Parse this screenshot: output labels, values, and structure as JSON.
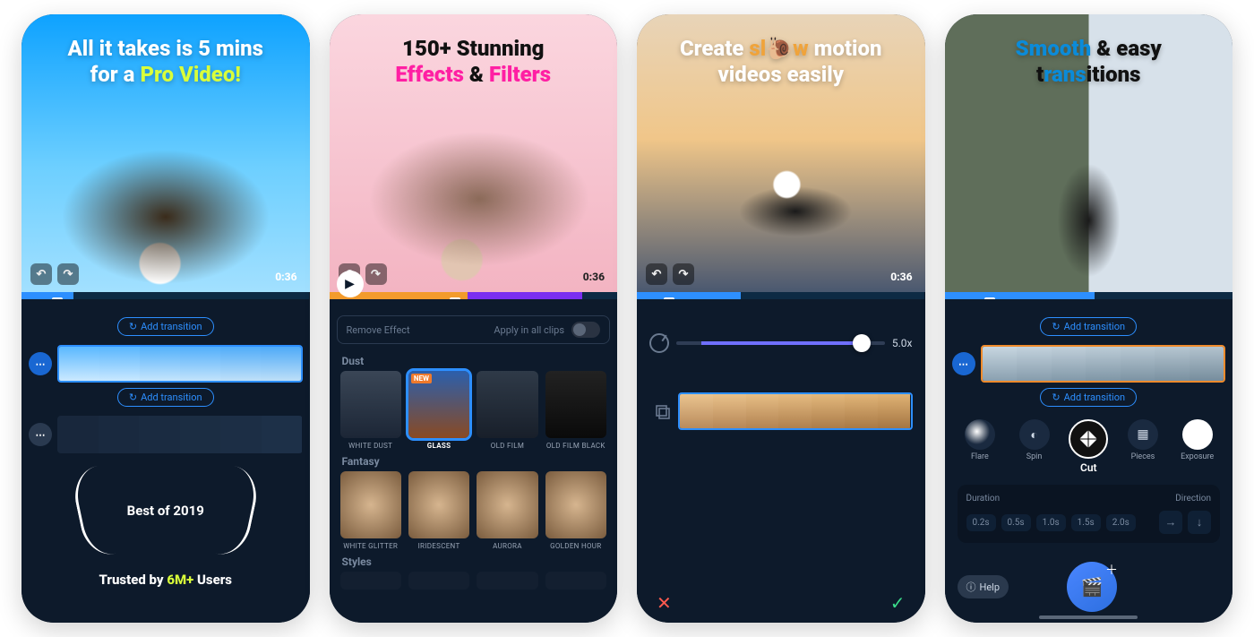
{
  "panel1": {
    "hero_line1": "All it takes is 5 mins",
    "hero_line2a": "for a ",
    "hero_line2b": "Pro Video!",
    "timecode": "0:36",
    "add_transition": "Add transition",
    "best_of": "Best of 2019",
    "trusted_a": "Trusted by ",
    "trusted_b": "6M+",
    "trusted_c": " Users"
  },
  "panel2": {
    "hero_line1": "150+ Stunning",
    "hero_line2a": "Effects",
    "hero_line2amp": " & ",
    "hero_line2b": "Filters",
    "timecode": "0:36",
    "remove_effect": "Remove Effect",
    "apply_all": "Apply in all clips",
    "section1": "Dust",
    "section2": "Fantasy",
    "section3": "Styles",
    "fx1": [
      "WHITE DUST",
      "GLASS",
      "OLD FILM",
      "OLD FILM BLACK"
    ],
    "fx1_sel": "GLASS",
    "fx1_new": "NEW",
    "fx2": [
      "WHITE GLITTER",
      "IRIDESCENT",
      "AURORA",
      "GOLDEN HOUR"
    ]
  },
  "panel3": {
    "hero_line1a": "Create ",
    "hero_line1b": "sl",
    "hero_line1c": "w",
    "hero_line1d": " motion",
    "hero_line2": "videos easily",
    "timecode": "0:36",
    "speed_value": "5.0x"
  },
  "panel4": {
    "hero_line1a": "Smooth",
    "hero_line1b": " & easy",
    "hero_line2a": "t",
    "hero_line2b": "rans",
    "hero_line2c": "itions",
    "add_transition": "Add transition",
    "transitions": [
      "Flare",
      "Spin",
      "Cut",
      "Pieces",
      "Exposure"
    ],
    "duration_label": "Duration",
    "direction_label": "Direction",
    "durations": [
      "0.2s",
      "0.5s",
      "1.0s",
      "1.5s",
      "2.0s"
    ],
    "help": "Help"
  }
}
